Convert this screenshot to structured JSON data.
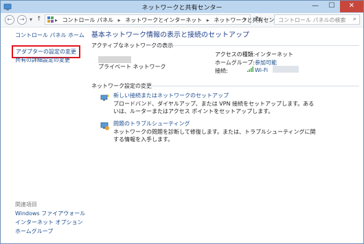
{
  "window": {
    "title": "ネットワークと共有センター",
    "min_glyph": "—",
    "max_glyph": "☐",
    "close_glyph": "✕"
  },
  "address_bar": {
    "back_glyph": "←",
    "forward_glyph": "→",
    "dropdown_glyph": "▾",
    "up_glyph": "↑",
    "breadcrumbs": [
      "コントロール パネル",
      "ネットワークとインターネット",
      "ネットワークと共有センター"
    ],
    "separator": "▸",
    "refresh_glyph": "↻",
    "search_placeholder": "コントロール パネルの検索",
    "search_glyph": "⌕"
  },
  "sidebar": {
    "home": "コントロール パネル ホーム",
    "adapter_settings": "アダプターの設定の変更",
    "sharing_settings": "共有の詳細設定の変更",
    "related_header": "関連項目",
    "related": [
      "Windows ファイアウォール",
      "インターネット オプション",
      "ホームグループ"
    ]
  },
  "main": {
    "title": "基本ネットワーク情報の表示と接続のセットアップ",
    "active_networks_header": "アクティブなネットワークの表示",
    "network_type": "プライベート ネットワーク",
    "access_type_label": "アクセスの種類:",
    "access_type_value": "インターネット",
    "homegroup_label": "ホームグループ:",
    "homegroup_value": "参加可能",
    "connection_label": "接続:",
    "connection_value": "Wi-Fi",
    "change_settings_header": "ネットワーク設定の変更",
    "tasks": [
      {
        "link": "新しい接続またはネットワークのセットアップ",
        "desc": "ブロードバンド、ダイヤルアップ、または VPN 接続をセットアップします。あるいは、ルーターまたはアクセス ポイントをセットアップします。"
      },
      {
        "link": "問題のトラブルシューティング",
        "desc": "ネットワークの問題を診断して修復します。または、トラブルシューティングに関する情報を入手します。"
      }
    ]
  },
  "colors": {
    "titlebar": "#bcd6f0",
    "link": "#1a4b8c",
    "heading": "#1e3f8a",
    "highlight_box": "#e3141b",
    "close_button": "#c7473d"
  }
}
